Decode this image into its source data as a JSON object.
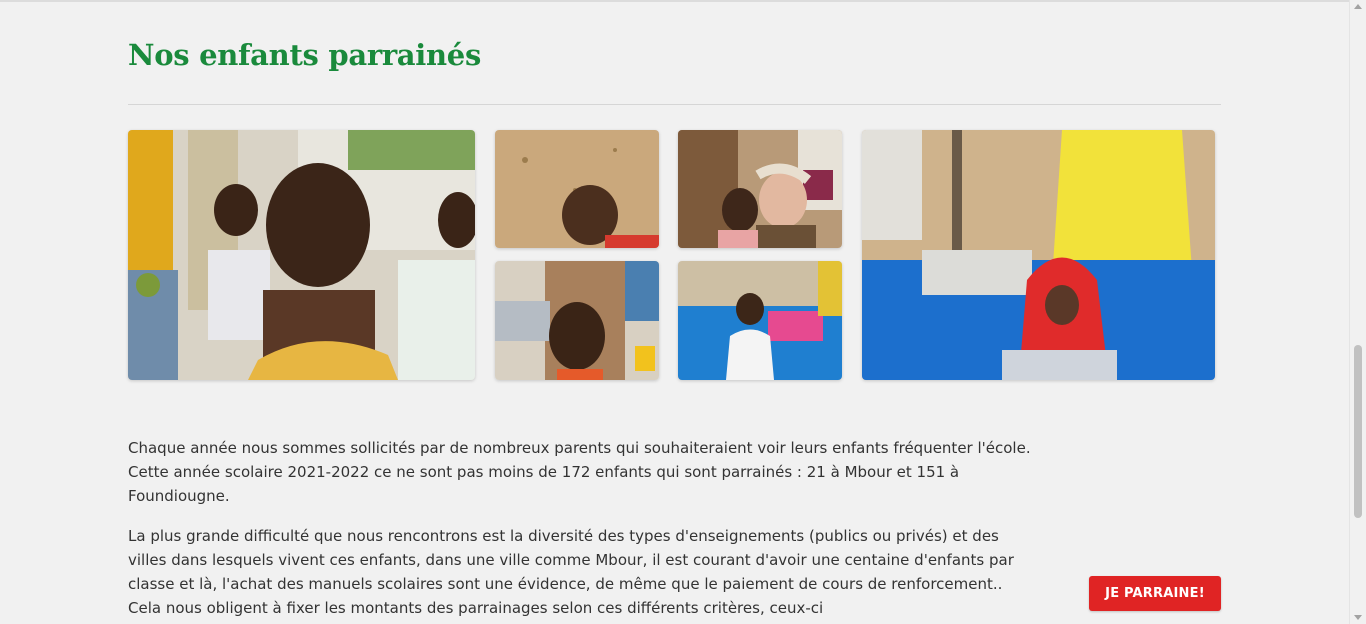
{
  "section": {
    "title": "Nos enfants parrainés"
  },
  "gallery": {
    "photos": [
      "photo-children-group",
      "photo-girl-sandy-ground",
      "photo-volunteer-with-child",
      "photo-girl-braids",
      "photo-girl-white-dress",
      "photo-girl-red-hijab"
    ]
  },
  "content": {
    "paragraph_1": "Chaque année nous sommes sollicités par de nombreux parents qui souhaiteraient voir leurs enfants fréquenter l'école. Cette année scolaire 2021-2022 ce ne sont pas moins de 172 enfants qui sont parrainés : 21 à Mbour et 151 à Foundiougne.",
    "paragraph_2": "La plus grande difficulté que nous rencontrons est la diversité des types d'enseignements (publics ou privés) et des villes dans lesquels vivent ces enfants, dans une ville comme Mbour, il est courant d'avoir une centaine d'enfants par classe et là, l'achat des manuels scolaires sont une évidence, de même que le paiement de cours de renforcement.. Cela nous obligent à fixer les montants des parrainages selon ces différents critères, ceux-ci"
  },
  "cta": {
    "label": "JE PARRAINE!"
  },
  "colors": {
    "title_green": "#1a8a3c",
    "cta_red": "#e02424",
    "background": "#f1f1f1"
  }
}
